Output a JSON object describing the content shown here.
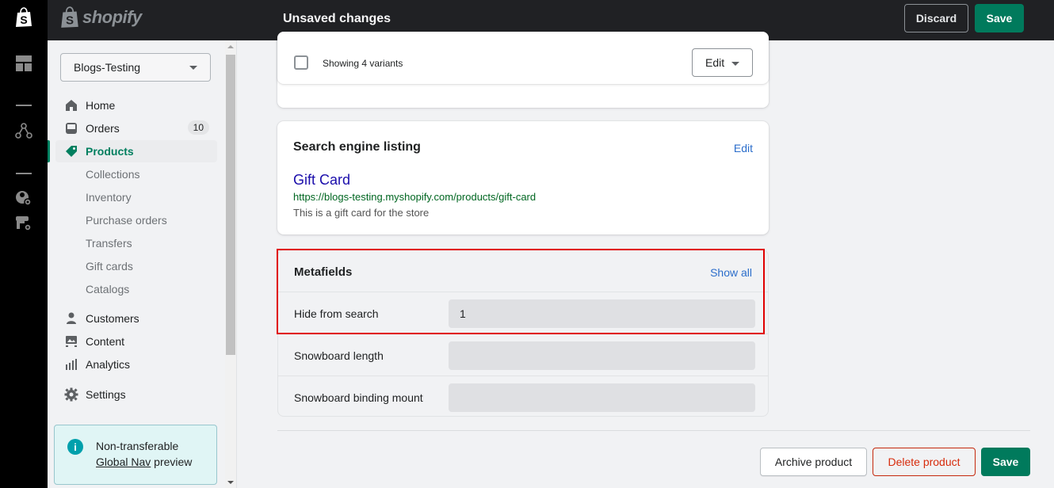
{
  "app": {
    "brand": "shopify",
    "accent_color": "#008060"
  },
  "topbar": {
    "title": "Unsaved changes",
    "discard_label": "Discard",
    "save_label": "Save"
  },
  "rail": {
    "icons": [
      "shopify-bag-icon",
      "dashboard-icon",
      "divider",
      "network-icon",
      "divider",
      "user-settings-icon",
      "store-settings-icon"
    ]
  },
  "sidebar": {
    "store_name": "Blogs-Testing",
    "items": [
      {
        "label": "Home",
        "icon": "home-icon",
        "type": "main"
      },
      {
        "label": "Orders",
        "icon": "orders-icon",
        "type": "main",
        "badge": "10"
      },
      {
        "label": "Products",
        "icon": "tag-icon",
        "type": "main",
        "active": true
      },
      {
        "label": "Collections",
        "type": "sub"
      },
      {
        "label": "Inventory",
        "type": "sub"
      },
      {
        "label": "Purchase orders",
        "type": "sub"
      },
      {
        "label": "Transfers",
        "type": "sub"
      },
      {
        "label": "Gift cards",
        "type": "sub"
      },
      {
        "label": "Catalogs",
        "type": "sub"
      },
      {
        "label": "Customers",
        "icon": "customer-icon",
        "type": "main"
      },
      {
        "label": "Content",
        "icon": "content-icon",
        "type": "main"
      },
      {
        "label": "Analytics",
        "icon": "analytics-icon",
        "type": "main"
      },
      {
        "label": "Settings",
        "icon": "gear-icon",
        "type": "main"
      }
    ],
    "notice": {
      "line1": "Non-transferable",
      "link": "Global Nav",
      "line2_suffix": " preview"
    }
  },
  "variants": {
    "label": "Showing 4 variants",
    "edit_label": "Edit"
  },
  "seo": {
    "title": "Search engine listing",
    "edit_label": "Edit",
    "page_title": "Gift Card",
    "url": "https://blogs-testing.myshopify.com/products/gift-card",
    "description": "This is a gift card for the store"
  },
  "metafields": {
    "title": "Metafields",
    "show_all_label": "Show all",
    "rows": [
      {
        "label": "Hide from search",
        "value": "1"
      },
      {
        "label": "Snowboard length",
        "value": ""
      },
      {
        "label": "Snowboard binding mount",
        "value": ""
      }
    ]
  },
  "footer": {
    "archive_label": "Archive product",
    "delete_label": "Delete product",
    "save_label": "Save"
  }
}
